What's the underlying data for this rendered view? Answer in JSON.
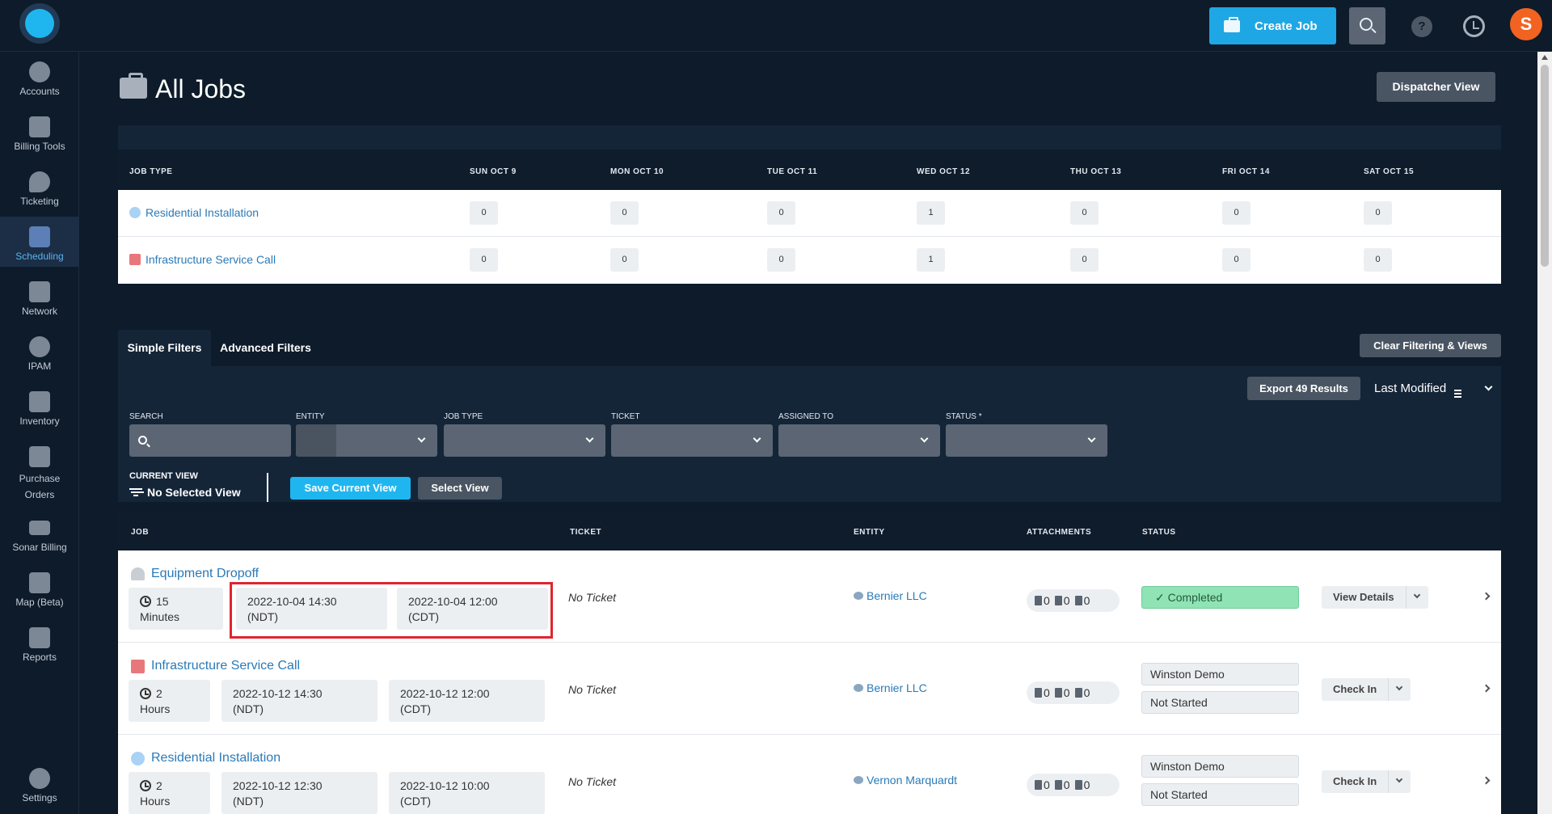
{
  "header": {
    "create_job_label": "Create Job",
    "help_label": "?",
    "avatar_initial": "S"
  },
  "sidebar": {
    "items": [
      {
        "label": "Accounts",
        "icon": "user-icon"
      },
      {
        "label": "Billing Tools",
        "icon": "abacus-icon"
      },
      {
        "label": "Ticketing",
        "icon": "chat-bubble-icon"
      },
      {
        "label": "Scheduling",
        "icon": "calendar-icon",
        "active": true
      },
      {
        "label": "Network",
        "icon": "network-icon"
      },
      {
        "label": "IPAM",
        "icon": "ipam-icon"
      },
      {
        "label": "Inventory",
        "icon": "dolly-icon"
      },
      {
        "label": "Purchase",
        "label2": "Orders",
        "icon": "purchase-orders-icon"
      },
      {
        "label": "Sonar Billing",
        "icon": "money-icon"
      },
      {
        "label": "Map (Beta)",
        "icon": "map-icon"
      },
      {
        "label": "Reports",
        "icon": "report-icon"
      },
      {
        "label": "Settings",
        "icon": "gear-icon"
      }
    ]
  },
  "page": {
    "title": "All Jobs",
    "dispatcher_view_label": "Dispatcher View"
  },
  "calendar": {
    "header_job_type": "JOB TYPE",
    "days": [
      "SUN OCT 9",
      "MON OCT 10",
      "TUE OCT 11",
      "WED OCT 12",
      "THU OCT 13",
      "FRI OCT 14",
      "SAT OCT 15"
    ],
    "rows": [
      {
        "job_type": "Residential Installation",
        "color": "#a9d2f5",
        "counts": [
          "0",
          "0",
          "0",
          "1",
          "0",
          "0",
          "0"
        ]
      },
      {
        "job_type": "Infrastructure Service Call",
        "color": "#e8777c",
        "counts": [
          "0",
          "0",
          "0",
          "1",
          "0",
          "0",
          "0"
        ]
      }
    ]
  },
  "filters": {
    "tab_simple": "Simple Filters",
    "tab_advanced": "Advanced Filters",
    "clear_label": "Clear Filtering & Views",
    "export_label": "Export 49 Results",
    "sort_label": "Last Modified",
    "labels": {
      "search": "SEARCH",
      "entity": "ENTITY",
      "job_type": "JOB TYPE",
      "ticket": "TICKET",
      "assigned_to": "ASSIGNED TO",
      "status": "STATUS *"
    },
    "current_view_label": "CURRENT VIEW",
    "current_view_value": "No Selected View",
    "save_view_label": "Save Current View",
    "select_view_label": "Select View"
  },
  "jobs_table": {
    "headers": {
      "job": "JOB",
      "ticket": "TICKET",
      "entity": "ENTITY",
      "attachments": "ATTACHMENTS",
      "status": "STATUS"
    },
    "rows": [
      {
        "title": "Equipment Dropoff",
        "duration_num": "15",
        "duration_unit": "Minutes",
        "time_ndt": "2022-10-04 14:30",
        "tz_ndt": "(NDT)",
        "time_cdt": "2022-10-04 12:00",
        "tz_cdt": "(CDT)",
        "ticket": "No Ticket",
        "entity": "Bernier LLC",
        "att": [
          "0",
          "0",
          "0"
        ],
        "status": "✓ Completed",
        "action": "View Details"
      },
      {
        "title": "Infrastructure Service Call",
        "duration_num": "2",
        "duration_unit": "Hours",
        "time_ndt": "2022-10-12 14:30",
        "tz_ndt": "(NDT)",
        "time_cdt": "2022-10-12 12:00",
        "tz_cdt": "(CDT)",
        "ticket": "No Ticket",
        "entity": "Bernier LLC",
        "att": [
          "0",
          "0",
          "0"
        ],
        "assigned": "Winston Demo",
        "status": "Not Started",
        "action": "Check In"
      },
      {
        "title": "Residential Installation",
        "duration_num": "2",
        "duration_unit": "Hours",
        "time_ndt": "2022-10-12 12:30",
        "tz_ndt": "(NDT)",
        "time_cdt": "2022-10-12 10:00",
        "tz_cdt": "(CDT)",
        "ticket": "No Ticket",
        "entity": "Vernon Marquardt",
        "att": [
          "0",
          "0",
          "0"
        ],
        "assigned": "Winston Demo",
        "status": "Not Started",
        "action": "Check In"
      }
    ]
  }
}
